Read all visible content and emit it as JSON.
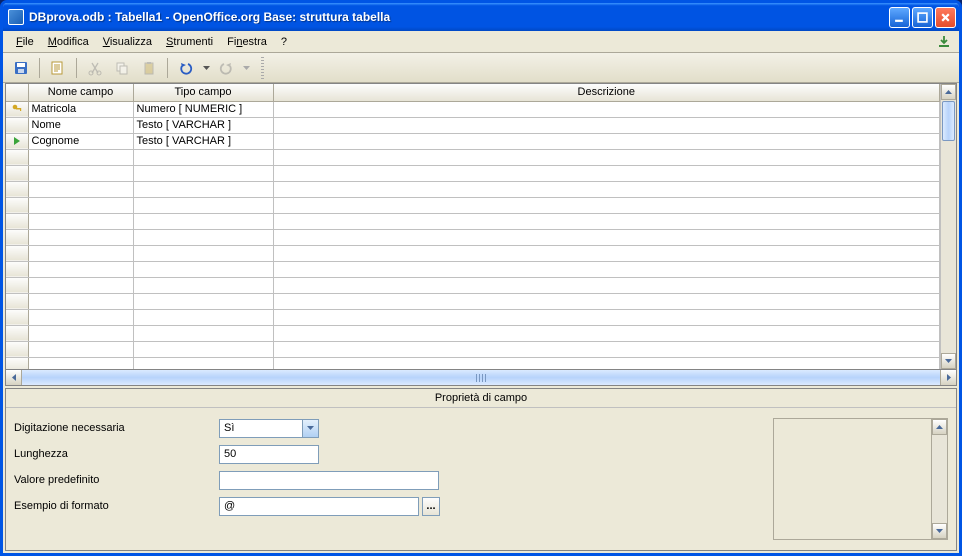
{
  "window": {
    "title": "DBprova.odb : Tabella1 - OpenOffice.org Base: struttura tabella"
  },
  "menu": {
    "file": "File",
    "modifica": "Modifica",
    "visualizza": "Visualizza",
    "strumenti": "Strumenti",
    "finestra": "Finestra",
    "help": "?"
  },
  "grid": {
    "headers": {
      "name": "Nome campo",
      "type": "Tipo campo",
      "desc": "Descrizione"
    },
    "rows": [
      {
        "marker": "key",
        "name": "Matricola",
        "type": "Numero [ NUMERIC ]",
        "desc": ""
      },
      {
        "marker": "",
        "name": "Nome",
        "type": "Testo [ VARCHAR ]",
        "desc": ""
      },
      {
        "marker": "current",
        "name": "Cognome",
        "type": "Testo [ VARCHAR ]",
        "desc": ""
      }
    ]
  },
  "props": {
    "title": "Proprietà di campo",
    "required_label": "Digitazione necessaria",
    "required_value": "Sì",
    "length_label": "Lunghezza",
    "length_value": "50",
    "default_label": "Valore predefinito",
    "default_value": "",
    "format_label": "Esempio di formato",
    "format_value": "@",
    "more": "..."
  }
}
